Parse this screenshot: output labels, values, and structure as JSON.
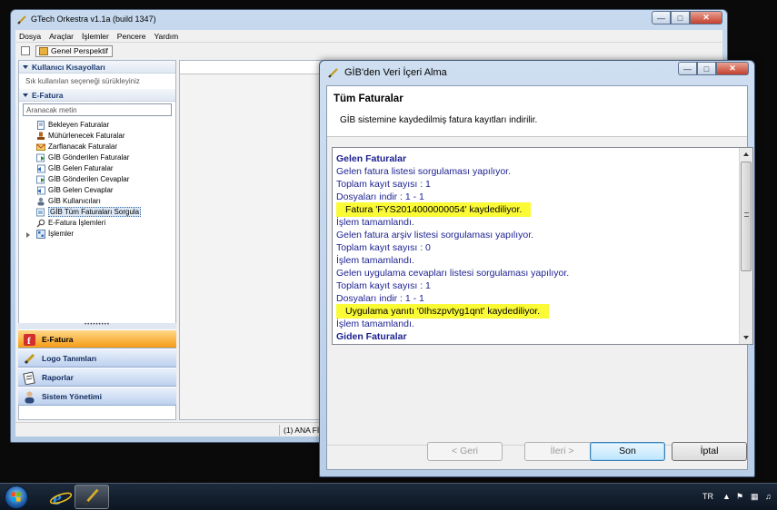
{
  "main_window": {
    "title": "GTech Orkestra v1.1a (build 1347)",
    "menu": [
      "Dosya",
      "Araçlar",
      "İşlemler",
      "Pencere",
      "Yardım"
    ],
    "perspective_button": "Genel Perspektif",
    "shortcuts_header": "Kullanıcı Kısayolları",
    "shortcuts_hint": "Sık kullanılan seçeneği sürükleyiniz",
    "efatura_header": "E-Fatura",
    "search_placeholder": "Aranacak metin",
    "tree_items": [
      {
        "label": "Bekleyen Faturalar",
        "icon": "document-icon"
      },
      {
        "label": "Mühürlenecek Faturalar",
        "icon": "stamp-icon"
      },
      {
        "label": "Zarflanacak Faturalar",
        "icon": "envelope-icon"
      },
      {
        "label": "GİB Gönderilen Faturalar",
        "icon": "sent-icon"
      },
      {
        "label": "GİB Gelen Faturalar",
        "icon": "received-icon"
      },
      {
        "label": "GİB Gönderilen Cevaplar",
        "icon": "sent-reply-icon"
      },
      {
        "label": "GİB Gelen Cevaplar",
        "icon": "received-reply-icon"
      },
      {
        "label": "GİB Kullanıcıları",
        "icon": "users-icon"
      },
      {
        "label": "GİB Tüm Faturaları Sorgula",
        "icon": "query-icon",
        "selected": true
      },
      {
        "label": "E-Fatura İşlemleri",
        "icon": "search-icon"
      },
      {
        "label": "İşlemler",
        "icon": "operations-icon",
        "expandable": true
      }
    ],
    "nav_items": [
      {
        "label": "E-Fatura",
        "icon": "efatura-icon",
        "active": true
      },
      {
        "label": "Logo Tanımları",
        "icon": "logo-icon"
      },
      {
        "label": "Raporlar",
        "icon": "reports-icon"
      },
      {
        "label": "Sistem Yönetimi",
        "icon": "admin-icon"
      }
    ],
    "status_text": "(1) ANA FİR..."
  },
  "dialog": {
    "title": "GİB'den Veri İçeri Alma",
    "heading": "Tüm Faturalar",
    "subtitle": "GİB sistemine kaydedilmiş fatura kayıtları indirilir.",
    "log": [
      {
        "text": "Gelen Faturalar",
        "style": "bold"
      },
      {
        "text": "Gelen fatura listesi sorgulaması yapılıyor.",
        "style": "normal"
      },
      {
        "text": "Toplam kayıt sayısı : 1",
        "style": "normal"
      },
      {
        "text": "Dosyaları indir : 1 - 1",
        "style": "normal"
      },
      {
        "text": "Fatura 'FYS2014000000054' kaydediliyor.",
        "style": "highlight"
      },
      {
        "text": "İşlem tamamlandı.",
        "style": "normal"
      },
      {
        "text": "Gelen fatura arşiv listesi sorgulaması yapılıyor.",
        "style": "normal"
      },
      {
        "text": "Toplam kayıt sayısı : 0",
        "style": "normal"
      },
      {
        "text": "İşlem tamamlandı.",
        "style": "normal"
      },
      {
        "text": "Gelen uygulama cevapları listesi sorgulaması yapılıyor.",
        "style": "normal"
      },
      {
        "text": "Toplam kayıt sayısı : 1",
        "style": "normal"
      },
      {
        "text": "Dosyaları indir : 1 - 1",
        "style": "normal"
      },
      {
        "text": "Uygulama yanıtı '0Ihszpvtyg1qnt' kaydediliyor.",
        "style": "highlight"
      },
      {
        "text": "İşlem tamamlandı.",
        "style": "normal"
      },
      {
        "text": "Giden Faturalar",
        "style": "bold"
      }
    ],
    "buttons": {
      "back": "< Geri",
      "next": "İleri >",
      "finish": "Son",
      "cancel": "İptal"
    }
  },
  "taskbar": {
    "language": "TR"
  },
  "colors": {
    "log_text": "#1b1f8f",
    "highlight": "#fafa36",
    "nav_active": "#f59b15"
  }
}
